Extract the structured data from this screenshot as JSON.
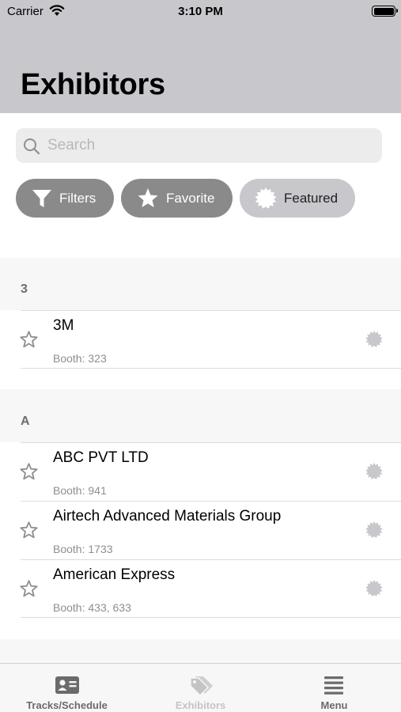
{
  "status": {
    "carrier": "Carrier",
    "time": "3:10 PM"
  },
  "header": {
    "title": "Exhibitors"
  },
  "search": {
    "placeholder": "Search",
    "value": ""
  },
  "filters": {
    "filters_label": "Filters",
    "favorite_label": "Favorite",
    "featured_label": "Featured"
  },
  "sections": [
    {
      "letter": "3",
      "items": [
        {
          "name": "3M",
          "booth": "Booth: 323"
        }
      ]
    },
    {
      "letter": "A",
      "items": [
        {
          "name": "ABC PVT LTD",
          "booth": "Booth: 941"
        },
        {
          "name": "Airtech Advanced Materials Group",
          "booth": "Booth: 1733"
        },
        {
          "name": "American Express",
          "booth": "Booth: 433, 633"
        }
      ]
    }
  ],
  "tabbar": {
    "tabs": [
      {
        "label": "Tracks/Schedule",
        "icon": "id-card-icon"
      },
      {
        "label": "Exhibitors",
        "icon": "tags-icon"
      },
      {
        "label": "Menu",
        "icon": "menu-icon"
      }
    ]
  },
  "colors": {
    "header_bg": "#c8c7cc",
    "pill_dark": "#8a8a8a",
    "pill_light": "#c7c7cc",
    "active_tab": "#c4c4c4"
  }
}
